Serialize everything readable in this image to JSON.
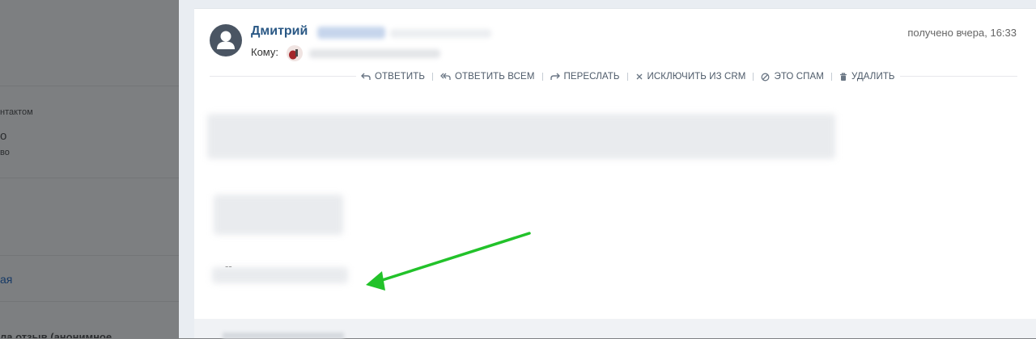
{
  "sidebar": {
    "contact_label_fragment": "нтактом",
    "value_fragment_1": "о",
    "value_fragment_2": "во",
    "link_fragment": "ая",
    "bottom_fragment": "ла отзыв (анонимное"
  },
  "message": {
    "sender_name": "Дмитрий",
    "to_label": "Кому:",
    "received": "получено вчера, 16:33",
    "signature_dash": "--"
  },
  "actions": [
    {
      "label": "Ответить",
      "icon": "reply-icon"
    },
    {
      "label": "Ответить всем",
      "icon": "reply-all-icon"
    },
    {
      "label": "Переслать",
      "icon": "forward-icon"
    },
    {
      "label": "Исключить из CRM",
      "icon": "close-icon"
    },
    {
      "label": "Это спам",
      "icon": "spam-icon"
    },
    {
      "label": "Удалить",
      "icon": "trash-icon"
    }
  ],
  "colors": {
    "accent": "#2a5885",
    "annotation_arrow": "#22c22a"
  }
}
